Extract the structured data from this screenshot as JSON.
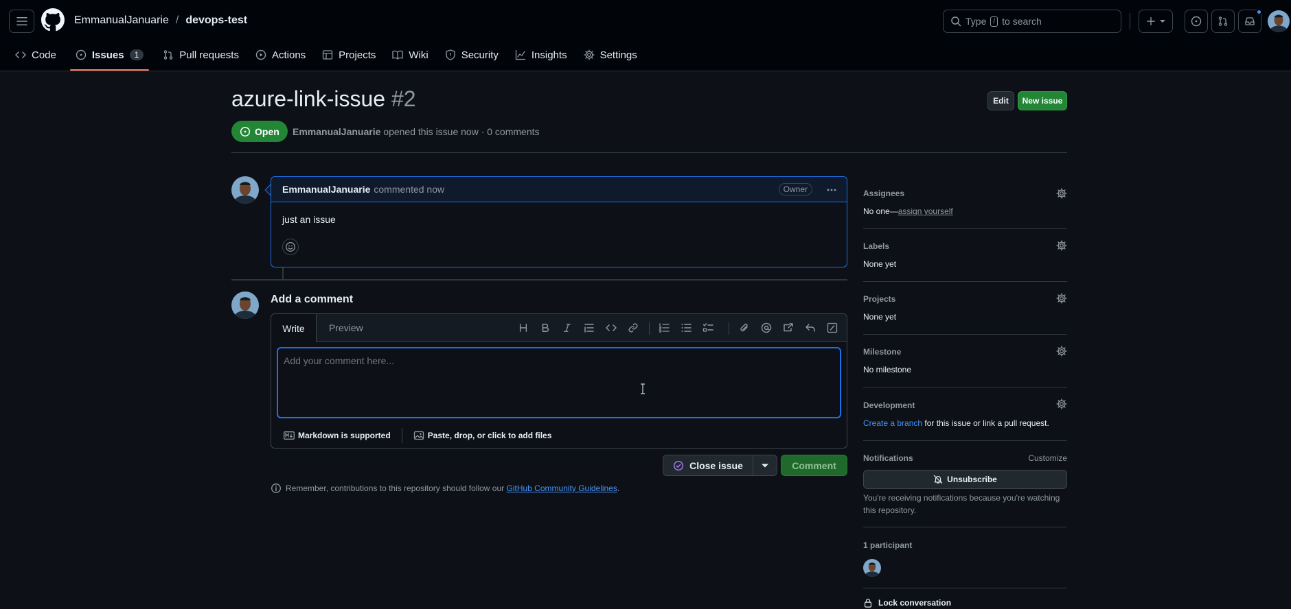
{
  "header": {
    "owner": "EmmanualJanuarie",
    "separator": "/",
    "repo": "devops-test",
    "search_prefix": "Type",
    "search_key": "/",
    "search_suffix": "to search"
  },
  "nav": {
    "code": "Code",
    "issues": "Issues",
    "issues_count": "1",
    "pull_requests": "Pull requests",
    "actions": "Actions",
    "projects": "Projects",
    "wiki": "Wiki",
    "security": "Security",
    "insights": "Insights",
    "settings": "Settings"
  },
  "issue": {
    "title": "azure-link-issue",
    "number": "#2",
    "edit_label": "Edit",
    "new_issue_label": "New issue",
    "state": "Open",
    "author": "EmmanualJanuarie",
    "meta_rest": "opened this issue now · 0 comments"
  },
  "comment": {
    "author": "EmmanualJanuarie",
    "time": "commented now",
    "badge": "Owner",
    "body": "just an issue"
  },
  "add_comment": {
    "title": "Add a comment",
    "tab_write": "Write",
    "tab_preview": "Preview",
    "placeholder": "Add your comment here...",
    "markdown_note": "Markdown is supported",
    "files_note": "Paste, drop, or click to add files",
    "close_label": "Close issue",
    "comment_label": "Comment",
    "guidelines_prefix": "Remember, contributions to this repository should follow our",
    "guidelines_link": "GitHub Community Guidelines",
    "guidelines_suffix": "."
  },
  "sidebar": {
    "assignees_title": "Assignees",
    "assignees_none": "No one—",
    "assignees_link": "assign yourself",
    "labels_title": "Labels",
    "labels_value": "None yet",
    "projects_title": "Projects",
    "projects_value": "None yet",
    "milestone_title": "Milestone",
    "milestone_value": "No milestone",
    "development_title": "Development",
    "development_link": "Create a branch",
    "development_rest": "for this issue or link a pull request.",
    "notifications_title": "Notifications",
    "notifications_customize": "Customize",
    "unsubscribe_label": "Unsubscribe",
    "notifications_note": "You're receiving notifications because you're watching this repository.",
    "participants_title": "1 participant",
    "lock_label": "Lock conversation"
  },
  "colors": {
    "background": "#0d1117",
    "header": "#010409",
    "accent_blue": "#4493f8",
    "open_green": "#238636",
    "tab_underline": "#f78166",
    "close_purple": "#ab7df8"
  },
  "icons": [
    "hamburger-icon",
    "github-logo-icon",
    "search-icon",
    "plus-icon",
    "issue-icon",
    "pull-request-icon",
    "inbox-icon",
    "code-icon",
    "play-icon",
    "table-icon",
    "book-icon",
    "shield-icon",
    "graph-icon",
    "gear-icon",
    "kebab-icon",
    "smiley-icon",
    "markdown-icon",
    "image-icon",
    "check-circle-icon",
    "info-icon",
    "bell-slash-icon",
    "lock-icon"
  ]
}
